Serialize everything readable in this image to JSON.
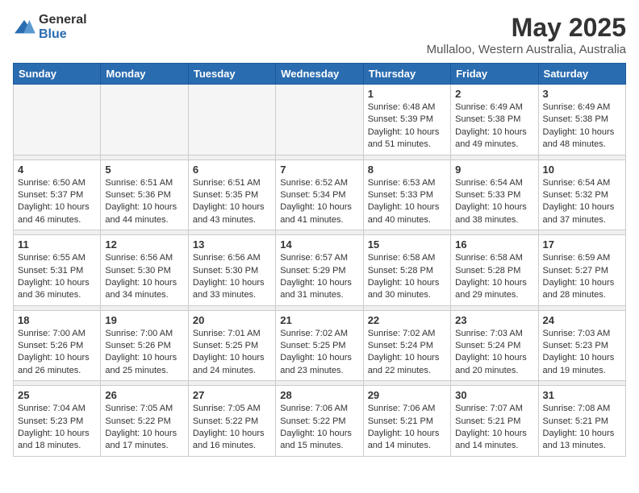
{
  "logo": {
    "general": "General",
    "blue": "Blue"
  },
  "title": "May 2025",
  "subtitle": "Mullaloo, Western Australia, Australia",
  "days_of_week": [
    "Sunday",
    "Monday",
    "Tuesday",
    "Wednesday",
    "Thursday",
    "Friday",
    "Saturday"
  ],
  "weeks": [
    {
      "cells": [
        {
          "day": "",
          "empty": true
        },
        {
          "day": "",
          "empty": true
        },
        {
          "day": "",
          "empty": true
        },
        {
          "day": "",
          "empty": true
        },
        {
          "day": "1",
          "sunrise": "6:48 AM",
          "sunset": "5:39 PM",
          "daylight": "10 hours and 51 minutes."
        },
        {
          "day": "2",
          "sunrise": "6:49 AM",
          "sunset": "5:38 PM",
          "daylight": "10 hours and 49 minutes."
        },
        {
          "day": "3",
          "sunrise": "6:49 AM",
          "sunset": "5:38 PM",
          "daylight": "10 hours and 48 minutes."
        }
      ]
    },
    {
      "cells": [
        {
          "day": "4",
          "sunrise": "6:50 AM",
          "sunset": "5:37 PM",
          "daylight": "10 hours and 46 minutes."
        },
        {
          "day": "5",
          "sunrise": "6:51 AM",
          "sunset": "5:36 PM",
          "daylight": "10 hours and 44 minutes."
        },
        {
          "day": "6",
          "sunrise": "6:51 AM",
          "sunset": "5:35 PM",
          "daylight": "10 hours and 43 minutes."
        },
        {
          "day": "7",
          "sunrise": "6:52 AM",
          "sunset": "5:34 PM",
          "daylight": "10 hours and 41 minutes."
        },
        {
          "day": "8",
          "sunrise": "6:53 AM",
          "sunset": "5:33 PM",
          "daylight": "10 hours and 40 minutes."
        },
        {
          "day": "9",
          "sunrise": "6:54 AM",
          "sunset": "5:33 PM",
          "daylight": "10 hours and 38 minutes."
        },
        {
          "day": "10",
          "sunrise": "6:54 AM",
          "sunset": "5:32 PM",
          "daylight": "10 hours and 37 minutes."
        }
      ]
    },
    {
      "cells": [
        {
          "day": "11",
          "sunrise": "6:55 AM",
          "sunset": "5:31 PM",
          "daylight": "10 hours and 36 minutes."
        },
        {
          "day": "12",
          "sunrise": "6:56 AM",
          "sunset": "5:30 PM",
          "daylight": "10 hours and 34 minutes."
        },
        {
          "day": "13",
          "sunrise": "6:56 AM",
          "sunset": "5:30 PM",
          "daylight": "10 hours and 33 minutes."
        },
        {
          "day": "14",
          "sunrise": "6:57 AM",
          "sunset": "5:29 PM",
          "daylight": "10 hours and 31 minutes."
        },
        {
          "day": "15",
          "sunrise": "6:58 AM",
          "sunset": "5:28 PM",
          "daylight": "10 hours and 30 minutes."
        },
        {
          "day": "16",
          "sunrise": "6:58 AM",
          "sunset": "5:28 PM",
          "daylight": "10 hours and 29 minutes."
        },
        {
          "day": "17",
          "sunrise": "6:59 AM",
          "sunset": "5:27 PM",
          "daylight": "10 hours and 28 minutes."
        }
      ]
    },
    {
      "cells": [
        {
          "day": "18",
          "sunrise": "7:00 AM",
          "sunset": "5:26 PM",
          "daylight": "10 hours and 26 minutes."
        },
        {
          "day": "19",
          "sunrise": "7:00 AM",
          "sunset": "5:26 PM",
          "daylight": "10 hours and 25 minutes."
        },
        {
          "day": "20",
          "sunrise": "7:01 AM",
          "sunset": "5:25 PM",
          "daylight": "10 hours and 24 minutes."
        },
        {
          "day": "21",
          "sunrise": "7:02 AM",
          "sunset": "5:25 PM",
          "daylight": "10 hours and 23 minutes."
        },
        {
          "day": "22",
          "sunrise": "7:02 AM",
          "sunset": "5:24 PM",
          "daylight": "10 hours and 22 minutes."
        },
        {
          "day": "23",
          "sunrise": "7:03 AM",
          "sunset": "5:24 PM",
          "daylight": "10 hours and 20 minutes."
        },
        {
          "day": "24",
          "sunrise": "7:03 AM",
          "sunset": "5:23 PM",
          "daylight": "10 hours and 19 minutes."
        }
      ]
    },
    {
      "cells": [
        {
          "day": "25",
          "sunrise": "7:04 AM",
          "sunset": "5:23 PM",
          "daylight": "10 hours and 18 minutes."
        },
        {
          "day": "26",
          "sunrise": "7:05 AM",
          "sunset": "5:22 PM",
          "daylight": "10 hours and 17 minutes."
        },
        {
          "day": "27",
          "sunrise": "7:05 AM",
          "sunset": "5:22 PM",
          "daylight": "10 hours and 16 minutes."
        },
        {
          "day": "28",
          "sunrise": "7:06 AM",
          "sunset": "5:22 PM",
          "daylight": "10 hours and 15 minutes."
        },
        {
          "day": "29",
          "sunrise": "7:06 AM",
          "sunset": "5:21 PM",
          "daylight": "10 hours and 14 minutes."
        },
        {
          "day": "30",
          "sunrise": "7:07 AM",
          "sunset": "5:21 PM",
          "daylight": "10 hours and 14 minutes."
        },
        {
          "day": "31",
          "sunrise": "7:08 AM",
          "sunset": "5:21 PM",
          "daylight": "10 hours and 13 minutes."
        }
      ]
    }
  ],
  "labels": {
    "sunrise": "Sunrise:",
    "sunset": "Sunset:",
    "daylight": "Daylight:"
  }
}
